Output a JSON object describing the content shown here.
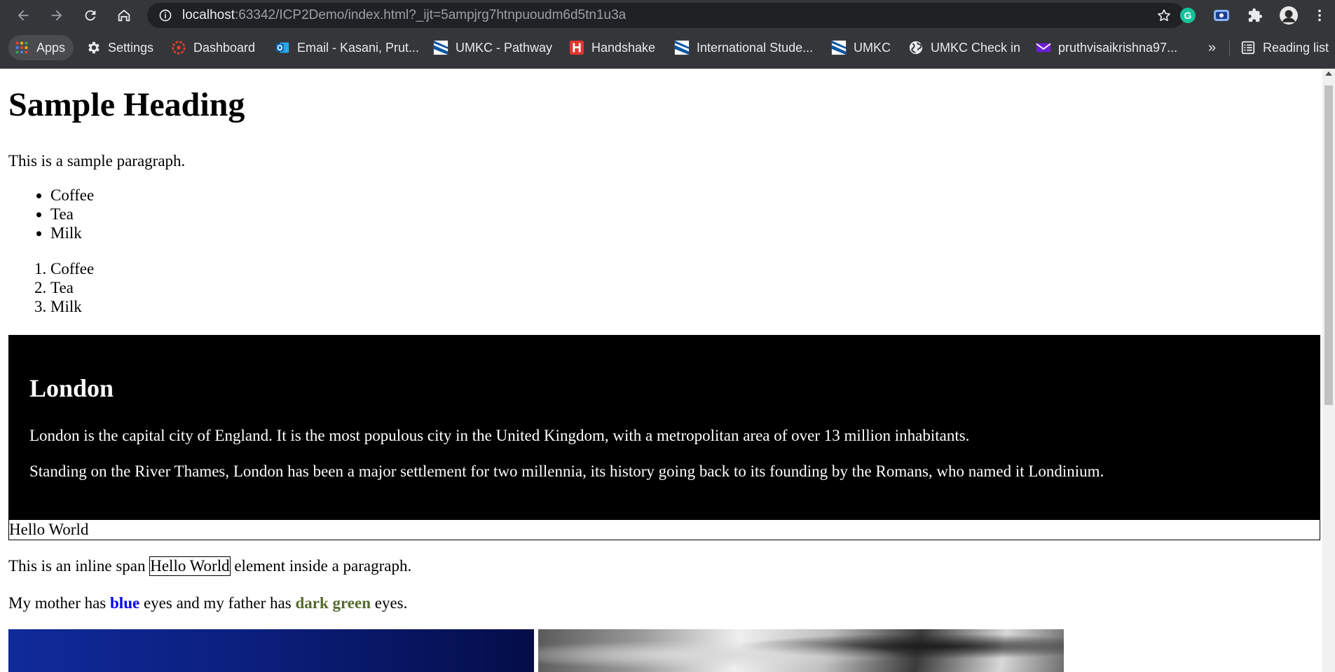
{
  "browser": {
    "url_host": "localhost",
    "url_rest": ":63342/ICP2Demo/index.html?_ijt=5ampjrg7htnpuoudm6d5tn1u3a",
    "icons": [
      "back-icon",
      "forward-icon",
      "reload-icon",
      "home-icon",
      "info-icon",
      "star-icon",
      "grammarly-icon",
      "screencast-icon",
      "extensions-icon",
      "profile-avatar",
      "menu-icon"
    ],
    "bookmarks": [
      {
        "label": "Apps",
        "icon": "apps-grid-icon"
      },
      {
        "label": "Settings",
        "icon": "gear-icon"
      },
      {
        "label": "Dashboard",
        "icon": "canvas-icon"
      },
      {
        "label": "Email - Kasani, Prut...",
        "icon": "outlook-icon"
      },
      {
        "label": "UMKC - Pathway",
        "icon": "umkc-icon"
      },
      {
        "label": "Handshake",
        "icon": "handshake-icon"
      },
      {
        "label": "International Stude...",
        "icon": "umkc-icon"
      },
      {
        "label": "UMKC",
        "icon": "umkc-icon"
      },
      {
        "label": "UMKC Check in",
        "icon": "globe-icon"
      },
      {
        "label": "pruthvisaikrishna97...",
        "icon": "email-icon"
      }
    ],
    "overflow": "»",
    "reading_list": "Reading list"
  },
  "page": {
    "heading": "Sample Heading",
    "paragraph": "This is a sample paragraph.",
    "unordered_list": [
      "Coffee",
      "Tea",
      "Milk"
    ],
    "ordered_list": [
      "Coffee",
      "Tea",
      "Milk"
    ],
    "city": {
      "title": "London",
      "p1": "London is the capital city of England. It is the most populous city in the United Kingdom, with a metropolitan area of over 13 million inhabitants.",
      "p2": "Standing on the River Thames, London has been a major settlement for two millennia, its history going back to its founding by the Romans, who named it Londinium."
    },
    "hello_div": "Hello World",
    "inline_span": {
      "before": "This is an inline span ",
      "span": "Hello World",
      "after": " element inside a paragraph."
    },
    "eyes": {
      "before": "My mother has ",
      "blue": "blue",
      "middle": " eyes and my father has ",
      "green": "dark green",
      "after": " eyes."
    },
    "colors": {
      "blue": "#0000ff",
      "dark_green": "#556b2f",
      "city_bg": "#000000"
    }
  }
}
